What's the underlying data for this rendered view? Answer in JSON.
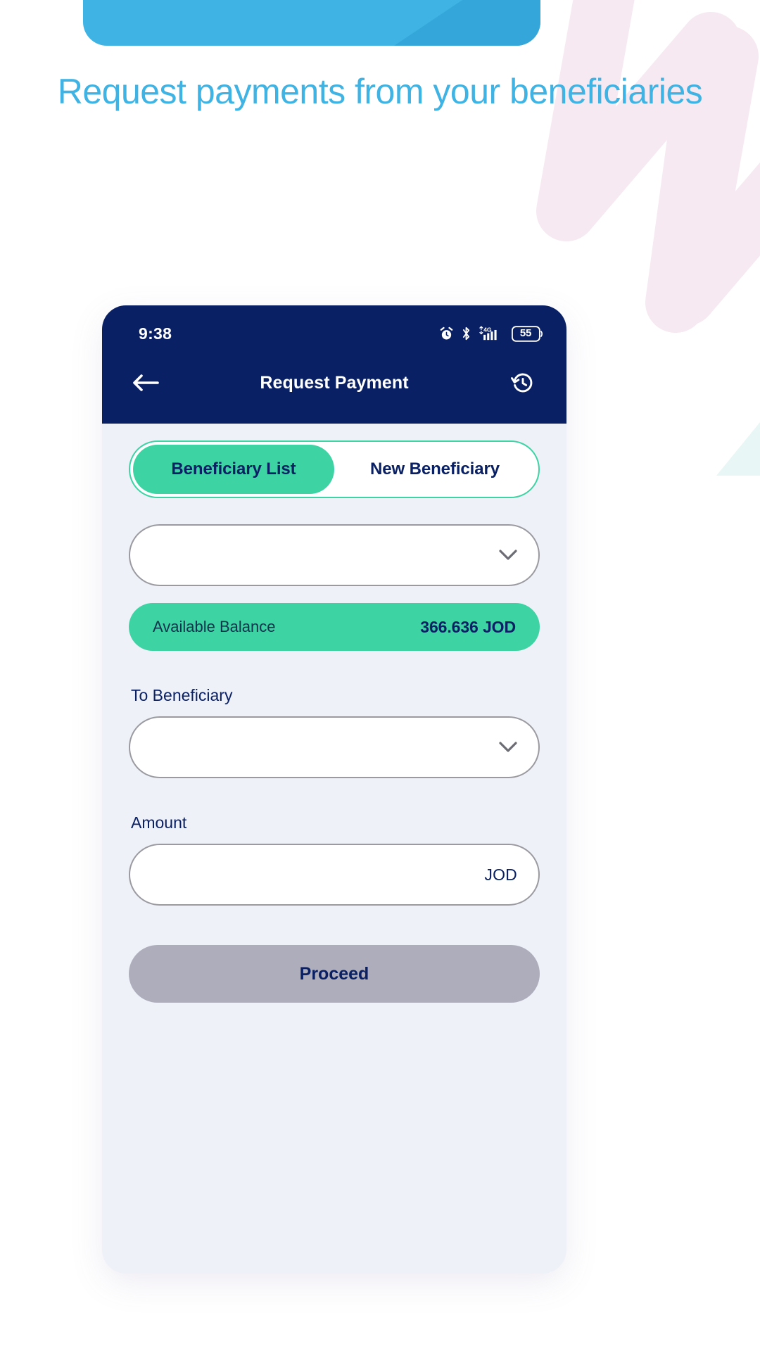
{
  "page": {
    "headline": "Request payments from your beneficiaries",
    "accent_blue": "#3FB3E3",
    "accent_green": "#3DD3A3",
    "navy": "#0A2064",
    "screen_bg": "#EFF1F9"
  },
  "phone": {
    "status_bar": {
      "time": "9:38",
      "alarm_icon": "alarm-clock-icon",
      "bluetooth_icon": "bluetooth-icon",
      "network_label": "4G",
      "signal_icon": "signal-bars-icon",
      "battery_level": "55"
    },
    "app_bar": {
      "back_icon": "arrow-left-icon",
      "title": "Request Payment",
      "history_icon": "history-clock-icon"
    },
    "tabs": [
      {
        "label": "Beneficiary List",
        "active": true
      },
      {
        "label": "New Beneficiary",
        "active": false
      }
    ],
    "account_select": {
      "value": "",
      "placeholder": "",
      "chevron_icon": "chevron-down-icon"
    },
    "balance": {
      "label": "Available Balance",
      "value": "366.636 JOD"
    },
    "beneficiary_field": {
      "label": "To Beneficiary",
      "value": "",
      "placeholder": "",
      "chevron_icon": "chevron-down-icon"
    },
    "amount_field": {
      "label": "Amount",
      "value": "",
      "placeholder": "",
      "currency_suffix": "JOD"
    },
    "proceed_button": {
      "label": "Proceed",
      "enabled": false
    }
  }
}
